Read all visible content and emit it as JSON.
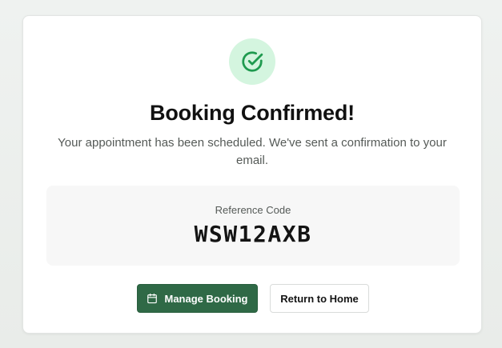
{
  "confirmation": {
    "title": "Booking Confirmed!",
    "message": "Your appointment has been scheduled. We've sent a confirmation to your email.",
    "status_icon": "check-circle-icon"
  },
  "reference": {
    "label": "Reference Code",
    "code": "WSW12AXB"
  },
  "actions": {
    "manage_label": "Manage Booking",
    "manage_icon": "calendar-icon",
    "home_label": "Return to Home"
  },
  "colors": {
    "accent": "#2f6946",
    "success_bg": "#d4f5df",
    "success_icon": "#1f9a4f"
  }
}
